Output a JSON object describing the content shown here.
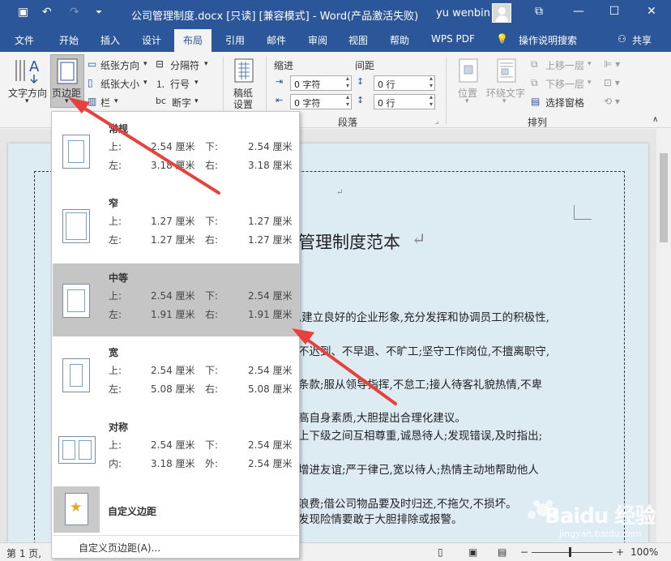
{
  "titlebar": {
    "title": "公司管理制度.docx [只读] [兼容模式] - Word(产品激活失败)",
    "user": "yu wenbin",
    "save_icon": "save-icon",
    "undo_icon": "undo-icon",
    "redo_icon": "redo-icon",
    "customize_icon": "customize-quick-access-icon",
    "ribbon_display_icon": "ribbon-display-options-icon",
    "minimize": "—",
    "restore": "☐",
    "close": "✕",
    "save_glyph": "▣",
    "undo_glyph": "↶",
    "redo_glyph": "↷",
    "customize_glyph": "⏷",
    "display_glyph": "⧉"
  },
  "menu": {
    "tabs": [
      "文件",
      "开始",
      "插入",
      "设计",
      "布局",
      "引用",
      "邮件",
      "审阅",
      "视图",
      "帮助",
      "WPS PDF",
      "操作说明搜索"
    ],
    "active_tab": "布局",
    "share": "共享"
  },
  "ribbon": {
    "text_direction": "文字方向",
    "margins": "页边距",
    "orientation": "纸张方向",
    "size": "纸张大小",
    "columns": "栏",
    "breaks": "分隔符",
    "line_numbers": "行号",
    "hyphenation": "断字",
    "draft_paper_1": "稿纸",
    "draft_paper_2": "设置",
    "indent_label": "缩进",
    "spacing_label": "间距",
    "indent_left": "0 字符",
    "indent_right": "0 字符",
    "spacing_before": "0 行",
    "spacing_after": "0 行",
    "paragraph_group": "段落",
    "position": "位置",
    "wrap_text": "环绕文字",
    "bring_forward": "上移一层",
    "send_backward": "下移一层",
    "selection_pane": "选择窗格",
    "arrange_group": "排列"
  },
  "margins_menu": {
    "options": [
      {
        "name": "常规",
        "top_label": "上:",
        "top": "2.54 厘米",
        "bottom_label": "下:",
        "bottom": "2.54 厘米",
        "left_label": "左:",
        "left": "3.18 厘米",
        "right_label": "右:",
        "right": "3.18 厘米"
      },
      {
        "name": "窄",
        "top_label": "上:",
        "top": "1.27 厘米",
        "bottom_label": "下:",
        "bottom": "1.27 厘米",
        "left_label": "左:",
        "left": "1.27 厘米",
        "right_label": "右:",
        "right": "1.27 厘米"
      },
      {
        "name": "中等",
        "top_label": "上:",
        "top": "2.54 厘米",
        "bottom_label": "下:",
        "bottom": "2.54 厘米",
        "left_label": "左:",
        "left": "1.91 厘米",
        "right_label": "右:",
        "right": "1.91 厘米"
      },
      {
        "name": "宽",
        "top_label": "上:",
        "top": "2.54 厘米",
        "bottom_label": "下:",
        "bottom": "2.54 厘米",
        "left_label": "左:",
        "left": "5.08 厘米",
        "right_label": "右:",
        "right": "5.08 厘米"
      },
      {
        "name": "对称",
        "top_label": "上:",
        "top": "2.54 厘米",
        "bottom_label": "下:",
        "bottom": "2.54 厘米",
        "left_label": "内:",
        "left": "3.18 厘米",
        "right_label": "外:",
        "right": "2.54 厘米"
      }
    ],
    "selected": "中等",
    "custom_margins": "自定义边距",
    "custom_margins_link": "自定义页边距(A)..."
  },
  "document": {
    "title": "管理制度范本",
    "lines": [
      ",建立良好的企业形象,充分发挥和协调员工的积极性,",
      "不迟到、不早退、不旷工;坚守工作岗位,不擅离职守,",
      "条款;服从领导指挥,不怠工;接人待客礼貌热情,不卑",
      "高自身素质,大胆提出合理化建议。",
      "上下级之间互相尊重,诚恳待人;发现错误,及时指出;",
      "增进友谊;严于律己,宽以待人;热情主动地帮助他人",
      "浪费;借公司物品要及时归还,不拖欠,不损坏。",
      "发现险情要敢于大胆排除或报警。"
    ],
    "para_mark": "↵"
  },
  "statusbar": {
    "page": "第 1 页,",
    "zoom": "100%"
  },
  "watermark": {
    "text": "Baidu 经验",
    "sub": "jingyan.baidu.com"
  }
}
